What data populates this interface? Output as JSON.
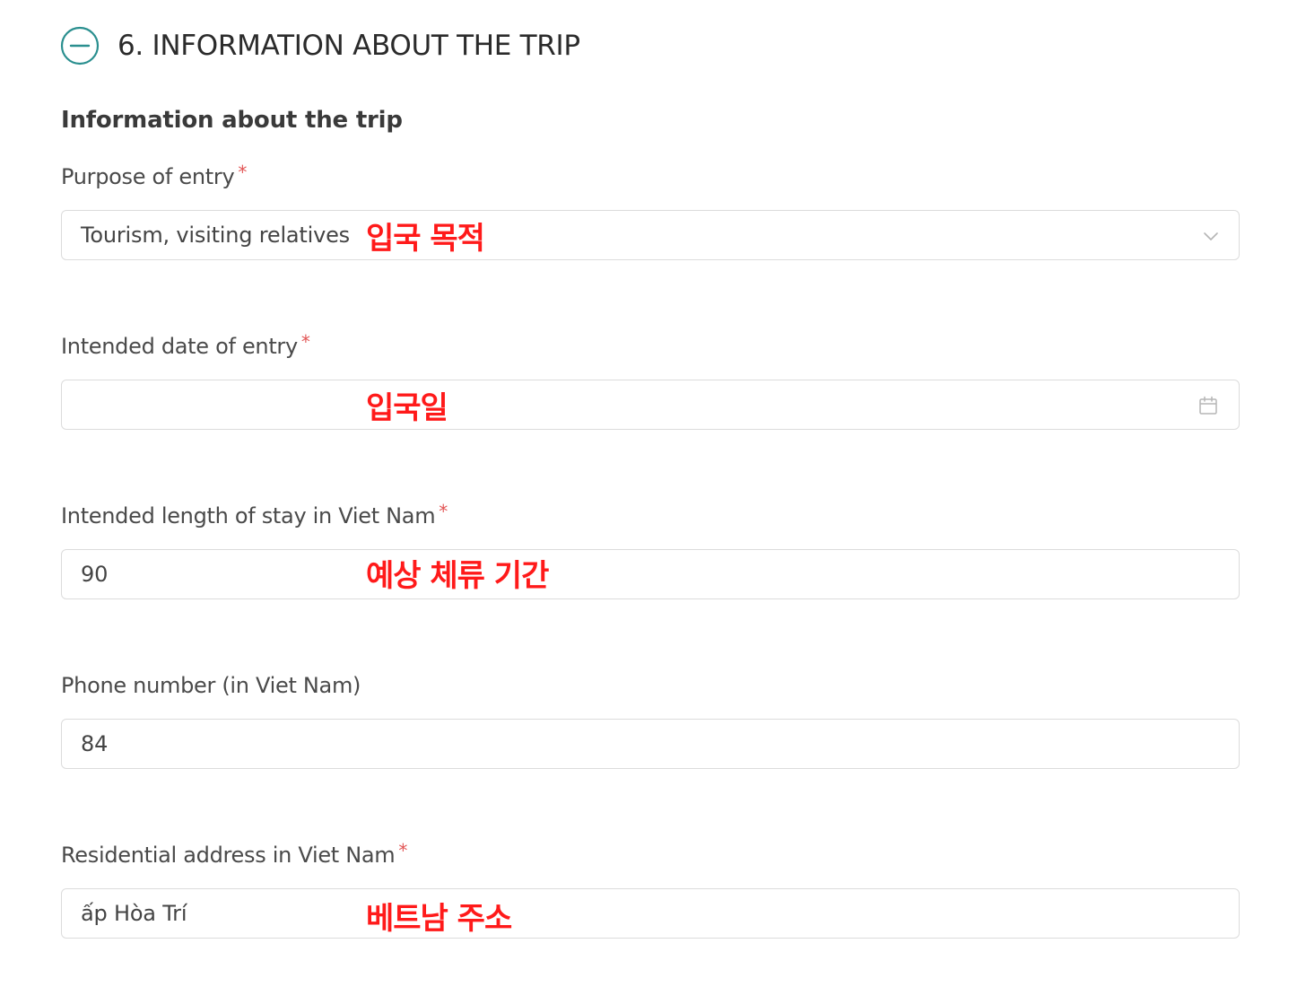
{
  "section": {
    "title": "6. INFORMATION ABOUT THE TRIP",
    "toggle_icon": "minus-circle-icon",
    "accent_color": "#2a8f8f"
  },
  "subsection_title": "Information about the trip",
  "fields": {
    "purpose": {
      "label": "Purpose of entry",
      "required_mark": "*",
      "value": "Tourism, visiting relatives",
      "annotation": "입국 목적",
      "icon": "chevron-down-icon"
    },
    "entry_date": {
      "label": "Intended date of entry",
      "required_mark": "*",
      "value": "",
      "annotation": "입국일",
      "icon": "calendar-icon"
    },
    "length_of_stay": {
      "label": "Intended length of stay in Viet Nam",
      "required_mark": "*",
      "value": "90",
      "annotation": "예상 체류 기간"
    },
    "phone": {
      "label": "Phone number (in Viet Nam)",
      "value": "84"
    },
    "address": {
      "label": "Residential address in Viet Nam",
      "required_mark": "*",
      "value": "ấp Hòa Trí",
      "annotation": "베트남 주소"
    }
  },
  "colors": {
    "required": "#e25555",
    "annotation": "#ff1a1a",
    "border": "#dcdcdc"
  }
}
